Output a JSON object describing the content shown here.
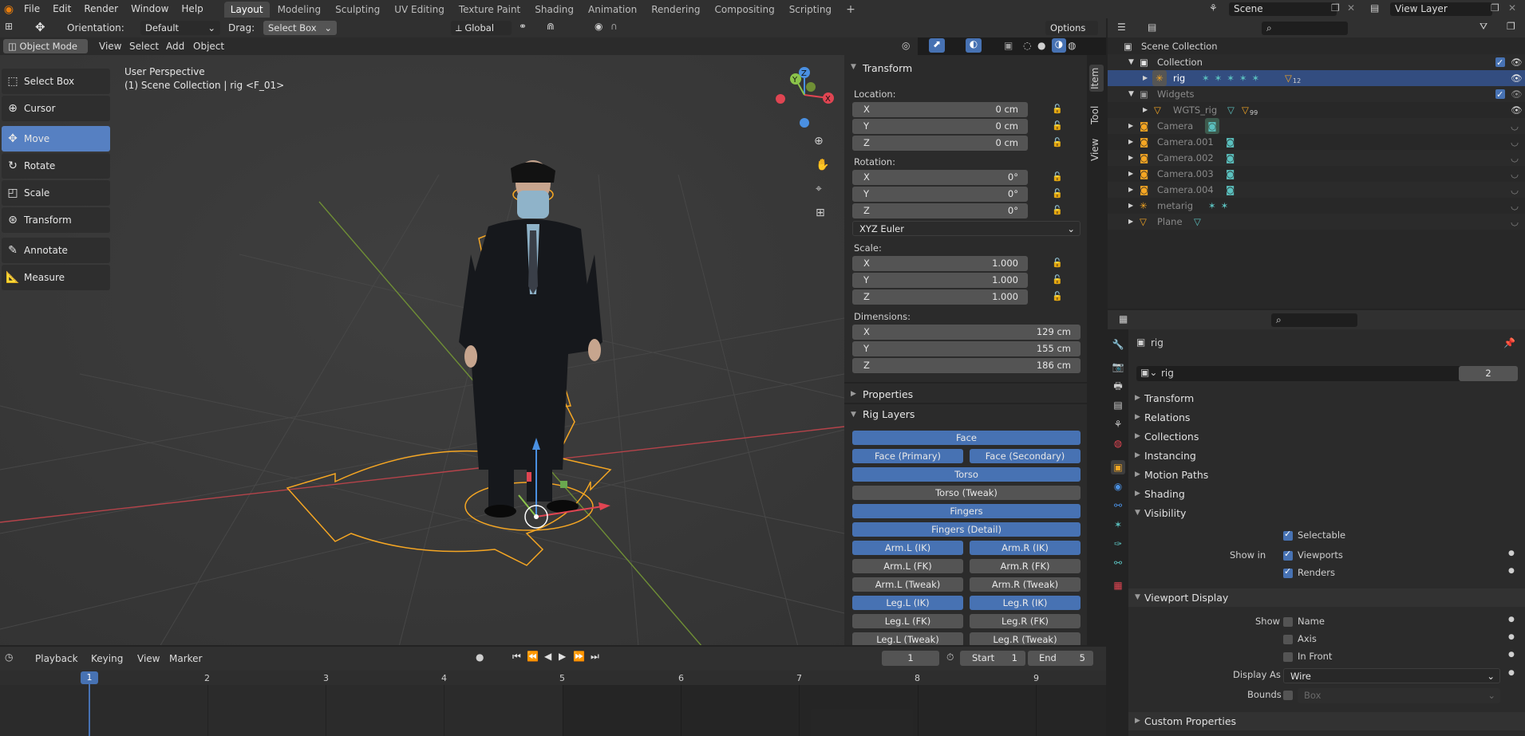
{
  "menu": [
    "File",
    "Edit",
    "Render",
    "Window",
    "Help"
  ],
  "workspaces": [
    "Layout",
    "Modeling",
    "Sculpting",
    "UV Editing",
    "Texture Paint",
    "Shading",
    "Animation",
    "Rendering",
    "Compositing",
    "Scripting"
  ],
  "active_workspace": "Layout",
  "scene": "Scene",
  "view_layer": "View Layer",
  "toolheader": {
    "orientation_label": "Orientation:",
    "orientation_value": "Default",
    "drag_label": "Drag:",
    "drag_value": "Select Box",
    "transform_orientation": "Global",
    "options": "Options"
  },
  "viewheader": {
    "mode": "Object Mode",
    "items": [
      "View",
      "Select",
      "Add",
      "Object"
    ]
  },
  "viewport": {
    "perspective": "User Perspective",
    "collection_info": "(1) Scene Collection | rig <F_01>",
    "gizmo": {
      "x": "X",
      "y": "Y",
      "z": "Z"
    }
  },
  "tools": [
    {
      "label": "Select Box",
      "icon": "select-box-icon",
      "active": false
    },
    {
      "label": "Cursor",
      "icon": "cursor-icon",
      "active": false
    },
    {
      "label": "Move",
      "icon": "move-icon",
      "active": true
    },
    {
      "label": "Rotate",
      "icon": "rotate-icon",
      "active": false
    },
    {
      "label": "Scale",
      "icon": "scale-icon",
      "active": false
    },
    {
      "label": "Transform",
      "icon": "transform-icon",
      "active": false
    },
    {
      "label": "Annotate",
      "icon": "annotate-icon",
      "active": false
    },
    {
      "label": "Measure",
      "icon": "measure-icon",
      "active": false
    }
  ],
  "npanel": {
    "tabs": [
      "Item",
      "Tool",
      "View"
    ],
    "transform_title": "Transform",
    "location_label": "Location:",
    "location": [
      {
        "axis": "X",
        "value": "0 cm"
      },
      {
        "axis": "Y",
        "value": "0 cm"
      },
      {
        "axis": "Z",
        "value": "0 cm"
      }
    ],
    "rotation_label": "Rotation:",
    "rotation": [
      {
        "axis": "X",
        "value": "0°"
      },
      {
        "axis": "Y",
        "value": "0°"
      },
      {
        "axis": "Z",
        "value": "0°"
      }
    ],
    "rotation_mode": "XYZ Euler",
    "scale_label": "Scale:",
    "scale": [
      {
        "axis": "X",
        "value": "1.000"
      },
      {
        "axis": "Y",
        "value": "1.000"
      },
      {
        "axis": "Z",
        "value": "1.000"
      }
    ],
    "dimensions_label": "Dimensions:",
    "dimensions": [
      {
        "axis": "X",
        "value": "129 cm"
      },
      {
        "axis": "Y",
        "value": "155 cm"
      },
      {
        "axis": "Z",
        "value": "186 cm"
      }
    ],
    "properties_title": "Properties",
    "rig_layers_title": "Rig Layers",
    "rig_layers": {
      "face": {
        "label": "Face",
        "on": true
      },
      "face_primary": {
        "label": "Face (Primary)",
        "on": true
      },
      "face_secondary": {
        "label": "Face (Secondary)",
        "on": true
      },
      "torso": {
        "label": "Torso",
        "on": true
      },
      "torso_tweak": {
        "label": "Torso (Tweak)",
        "on": false
      },
      "fingers": {
        "label": "Fingers",
        "on": true
      },
      "fingers_detail": {
        "label": "Fingers (Detail)",
        "on": true
      },
      "arm_l_ik": {
        "label": "Arm.L (IK)",
        "on": true
      },
      "arm_r_ik": {
        "label": "Arm.R (IK)",
        "on": true
      },
      "arm_l_fk": {
        "label": "Arm.L (FK)",
        "on": false
      },
      "arm_r_fk": {
        "label": "Arm.R (FK)",
        "on": false
      },
      "arm_l_tweak": {
        "label": "Arm.L (Tweak)",
        "on": false
      },
      "arm_r_tweak": {
        "label": "Arm.R (Tweak)",
        "on": false
      },
      "leg_l_ik": {
        "label": "Leg.L (IK)",
        "on": true
      },
      "leg_r_ik": {
        "label": "Leg.R (IK)",
        "on": true
      },
      "leg_l_fk": {
        "label": "Leg.L (FK)",
        "on": false
      },
      "leg_r_fk": {
        "label": "Leg.R (FK)",
        "on": false
      },
      "leg_l_tweak": {
        "label": "Leg.L (Tweak)",
        "on": false
      },
      "leg_r_tweak": {
        "label": "Leg.R (Tweak)",
        "on": false
      }
    }
  },
  "timeline": {
    "menus": [
      "Playback",
      "Keying",
      "View",
      "Marker"
    ],
    "current_frame": "1",
    "start_label": "Start",
    "start": "1",
    "end_label": "End",
    "end": "5",
    "ruler": [
      "1",
      "2",
      "3",
      "4",
      "5",
      "6",
      "7",
      "8",
      "9"
    ]
  },
  "outliner": {
    "root": "Scene Collection",
    "rows": [
      {
        "name": "Collection",
        "type": "collection"
      },
      {
        "name": "rig",
        "type": "armature",
        "badge": "12"
      },
      {
        "name": "Widgets",
        "type": "collection"
      },
      {
        "name": "WGTS_rig",
        "type": "mesh",
        "badge": "99"
      },
      {
        "name": "Camera",
        "type": "camera"
      },
      {
        "name": "Camera.001",
        "type": "camera"
      },
      {
        "name": "Camera.002",
        "type": "camera"
      },
      {
        "name": "Camera.003",
        "type": "camera"
      },
      {
        "name": "Camera.004",
        "type": "camera"
      },
      {
        "name": "metarig",
        "type": "armature"
      },
      {
        "name": "Plane",
        "type": "mesh"
      }
    ]
  },
  "properties": {
    "object_name": "rig",
    "data_name": "rig",
    "users": "2",
    "sections": [
      "Transform",
      "Relations",
      "Collections",
      "Instancing",
      "Motion Paths",
      "Shading",
      "Visibility"
    ],
    "selectable": "Selectable",
    "show_in": "Show in",
    "viewports": "Viewports",
    "renders": "Renders",
    "viewport_display": "Viewport Display",
    "show": "Show",
    "name": "Name",
    "axis": "Axis",
    "in_front": "In Front",
    "display_as_label": "Display As",
    "display_as": "Wire",
    "bounds_label": "Bounds",
    "bounds_value": "Box",
    "custom_properties": "Custom Properties"
  },
  "colors": {
    "accent": "#4772b3",
    "selection": "#334d80",
    "rig_orange": "#f5a623",
    "x_axis": "#e04552",
    "y_axis": "#8bc34a",
    "z_axis": "#4a90e2"
  }
}
